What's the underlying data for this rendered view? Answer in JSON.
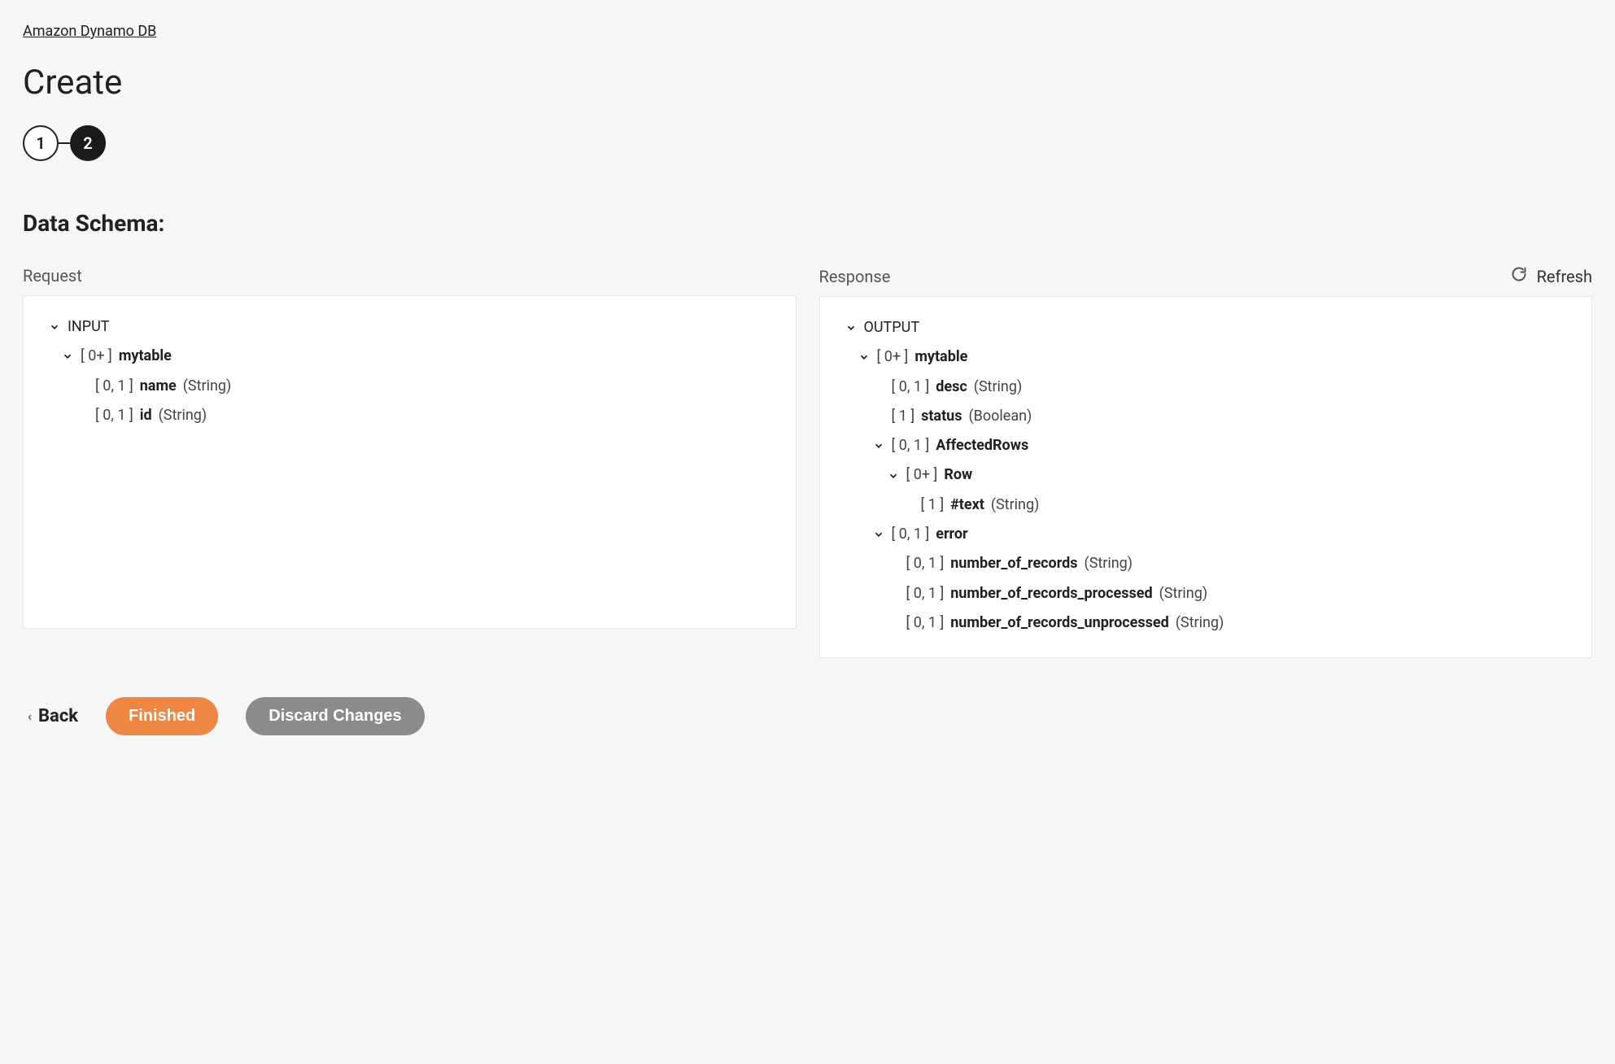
{
  "breadcrumb": "Amazon Dynamo DB",
  "title": "Create",
  "stepper": {
    "step1": "1",
    "step2": "2"
  },
  "section_title": "Data Schema:",
  "columns": {
    "request": "Request",
    "response": "Response"
  },
  "refresh_label": "Refresh",
  "request_tree": {
    "root": {
      "label": "INPUT"
    },
    "mytable": {
      "card": "[ 0+ ]",
      "name": "mytable"
    },
    "name": {
      "card": "[ 0, 1 ]",
      "name": "name",
      "type": "(String)"
    },
    "id": {
      "card": "[ 0, 1 ]",
      "name": "id",
      "type": "(String)"
    }
  },
  "response_tree": {
    "root": {
      "label": "OUTPUT"
    },
    "mytable": {
      "card": "[ 0+ ]",
      "name": "mytable"
    },
    "desc": {
      "card": "[ 0, 1 ]",
      "name": "desc",
      "type": "(String)"
    },
    "status": {
      "card": "[ 1 ]",
      "name": "status",
      "type": "(Boolean)"
    },
    "affected_rows": {
      "card": "[ 0, 1 ]",
      "name": "AffectedRows"
    },
    "row": {
      "card": "[ 0+ ]",
      "name": "Row"
    },
    "text": {
      "card": "[ 1 ]",
      "name": "#text",
      "type": "(String)"
    },
    "error": {
      "card": "[ 0, 1 ]",
      "name": "error"
    },
    "num_records": {
      "card": "[ 0, 1 ]",
      "name": "number_of_records",
      "type": "(String)"
    },
    "num_records_processed": {
      "card": "[ 0, 1 ]",
      "name": "number_of_records_processed",
      "type": "(String)"
    },
    "num_records_unprocessed": {
      "card": "[ 0, 1 ]",
      "name": "number_of_records_unprocessed",
      "type": "(String)"
    }
  },
  "footer": {
    "back": "Back",
    "finished": "Finished",
    "discard": "Discard Changes"
  }
}
